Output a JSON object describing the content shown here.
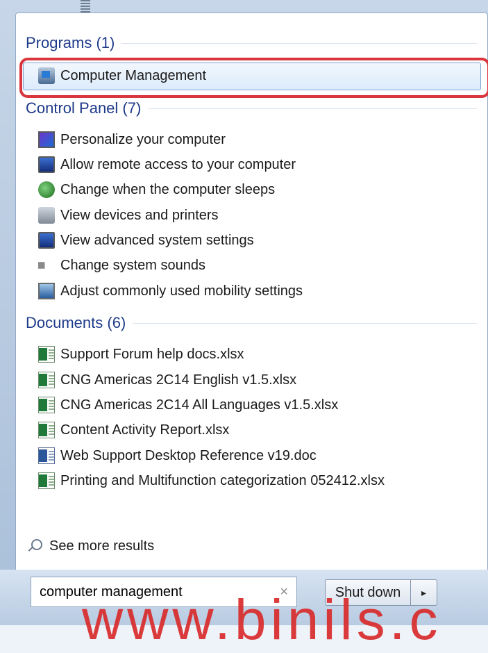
{
  "programs": {
    "header": "Programs (1)",
    "items": [
      {
        "label": "Computer Management",
        "icon": "computer-management-icon"
      }
    ]
  },
  "control_panel": {
    "header": "Control Panel (7)",
    "items": [
      {
        "label": "Personalize your computer",
        "icon": "personalize-icon"
      },
      {
        "label": "Allow remote access to your computer",
        "icon": "remote-access-icon"
      },
      {
        "label": "Change when the computer sleeps",
        "icon": "power-options-icon"
      },
      {
        "label": "View devices and printers",
        "icon": "devices-printers-icon"
      },
      {
        "label": "View advanced system settings",
        "icon": "system-settings-icon"
      },
      {
        "label": "Change system sounds",
        "icon": "speaker-icon"
      },
      {
        "label": "Adjust commonly used mobility settings",
        "icon": "mobility-center-icon"
      }
    ]
  },
  "documents": {
    "header": "Documents (6)",
    "items": [
      {
        "label": "Support Forum help docs.xlsx",
        "icon": "excel-file-icon"
      },
      {
        "label": "CNG Americas 2C14 English v1.5.xlsx",
        "icon": "excel-file-icon"
      },
      {
        "label": "CNG Americas 2C14 All Languages v1.5.xlsx",
        "icon": "excel-file-icon"
      },
      {
        "label": "Content Activity Report.xlsx",
        "icon": "excel-file-icon"
      },
      {
        "label": "Web Support Desktop Reference v19.doc",
        "icon": "word-file-icon"
      },
      {
        "label": "Printing and Multifunction categorization 052412.xlsx",
        "icon": "excel-file-icon"
      }
    ]
  },
  "see_more": "See more results",
  "search": {
    "value": "computer management",
    "clear": "×"
  },
  "shutdown": {
    "label": "Shut down",
    "arrow": "▸"
  },
  "watermark": "www.binils.c",
  "colors": {
    "header_blue": "#1e3a8a",
    "highlight_red": "#d9363e",
    "selection": "#dcebfc"
  }
}
